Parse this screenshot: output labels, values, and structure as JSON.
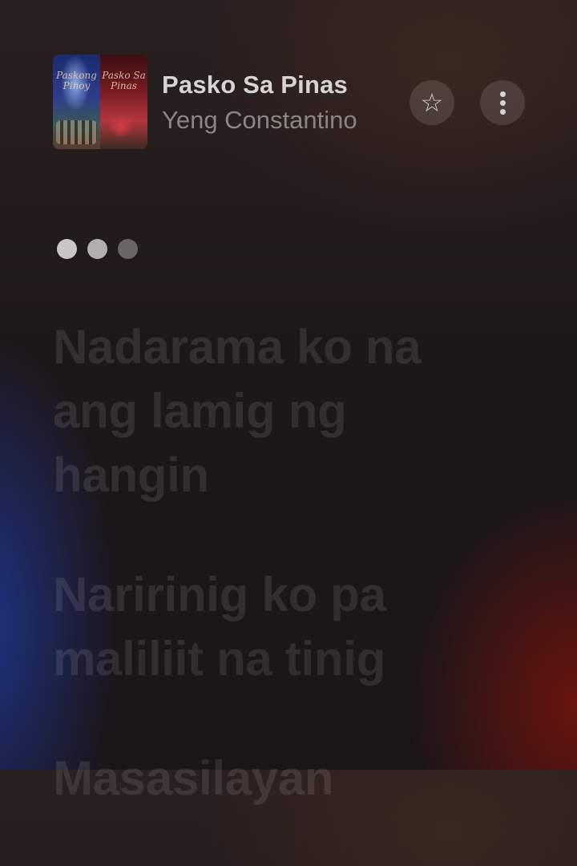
{
  "now_playing": {
    "artwork_icon": "album-artwork",
    "artwork_text_left": "Paskong Pinoy",
    "artwork_text_right": "Pasko Sa Pinas",
    "title": "Pasko Sa Pinas",
    "artist": "Yeng Constantino",
    "favorite_icon": "star-icon",
    "more_icon": "more-vertical-icon"
  },
  "waiting_indicator": {
    "icon": "ellipsis-dots-icon"
  },
  "lyrics": [
    "Nadarama ko na ang lamig ng hangin",
    "Naririnig ko pa maliliit na tinig",
    "Masasilayan"
  ],
  "colors": {
    "background_top": "#2a201f",
    "background_bottom": "#1b1518",
    "accent_blue": "#1e3caa",
    "accent_red": "#8c140a"
  }
}
